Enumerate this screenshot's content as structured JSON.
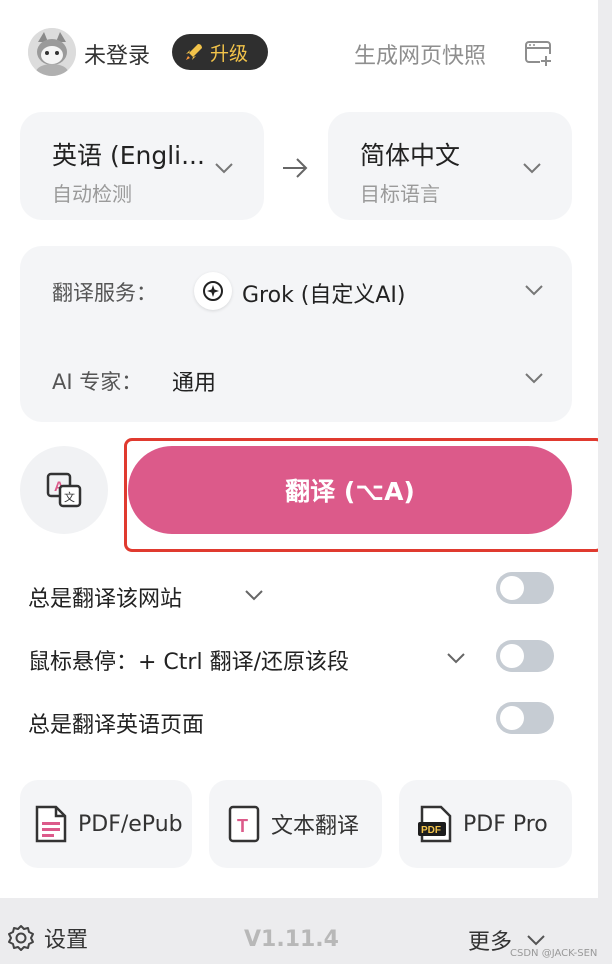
{
  "header": {
    "login_status": "未登录",
    "upgrade_label": "升级",
    "snapshot_label": "生成网页快照"
  },
  "languages": {
    "source": {
      "name": "英语 (Engli...",
      "sub": "自动检测"
    },
    "target": {
      "name": "简体中文",
      "sub": "目标语言"
    }
  },
  "service": {
    "service_label": "翻译服务：",
    "service_value": "Grok (自定义AI)",
    "expert_label": "AI 专家：",
    "expert_value": "通用"
  },
  "translate": {
    "button_label": "翻译 (⌥A)"
  },
  "options": [
    {
      "label": "总是翻译该网站",
      "has_dropdown": true,
      "enabled": false
    },
    {
      "label": "鼠标悬停：+ Ctrl 翻译/还原该段",
      "has_dropdown": true,
      "enabled": false
    },
    {
      "label": "总是翻译英语页面",
      "has_dropdown": false,
      "enabled": false
    }
  ],
  "tools": [
    {
      "label": "PDF/ePub",
      "icon": "pdf-file-icon"
    },
    {
      "label": "文本翻译",
      "icon": "text-translate-icon"
    },
    {
      "label": "PDF Pro",
      "icon": "pdf-pro-icon"
    }
  ],
  "footer": {
    "settings_label": "设置",
    "version": "V1.11.4",
    "more_label": "更多",
    "watermark": "CSDN @JACK-SEN"
  },
  "colors": {
    "translate_button": "#dc5a8a",
    "highlight_border": "#e03a2f",
    "upgrade_text": "#f2c34a"
  }
}
